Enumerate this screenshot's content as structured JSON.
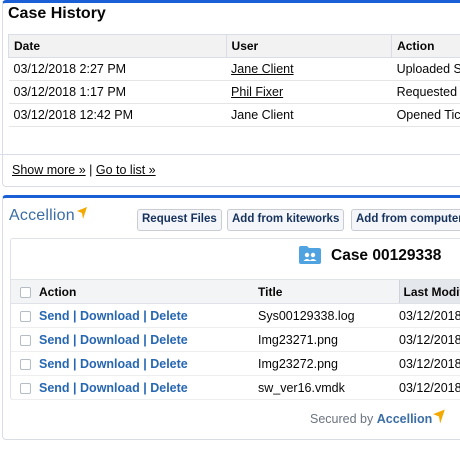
{
  "case_history": {
    "title": "Case History",
    "columns": [
      "Date",
      "User",
      "Action"
    ],
    "rows": [
      {
        "date": "03/12/2018 2:27 PM",
        "user": "Jane Client",
        "user_link": true,
        "action": "Uploaded S"
      },
      {
        "date": "03/12/2018 1:17 PM",
        "user": "Phil Fixer",
        "user_link": true,
        "action": "Requested"
      },
      {
        "date": "03/12/2018 12:42 PM",
        "user": "Jane Client",
        "user_link": false,
        "action": "Opened Tic"
      }
    ],
    "show_more": "Show more »",
    "separator": "|",
    "go_to_list": "Go to list »"
  },
  "accellion": {
    "logo_text": "Accellion",
    "buttons": [
      "Request Files",
      "Add from kiteworks",
      "Add from computer"
    ],
    "case_title": "Case 00129338",
    "columns": [
      "Action",
      "Title",
      "Last Modifi"
    ],
    "row_actions": {
      "send": "Send",
      "sep": "|",
      "download": "Download",
      "delete": "Delete"
    },
    "files": [
      {
        "title": "Sys00129338.log",
        "modified": "03/12/2018"
      },
      {
        "title": "Img23271.png",
        "modified": "03/12/2018"
      },
      {
        "title": "Img23272.png",
        "modified": "03/12/2018"
      },
      {
        "title": "sw_ver16.vmdk",
        "modified": "03/12/2018"
      }
    ],
    "secured_by": "Secured by",
    "secured_brand": "Accellion"
  },
  "colors": {
    "accent": "#1b5fd6",
    "link_blue": "#2767b1",
    "brand_blue": "#3a6ea5",
    "brand_orange": "#f2a900"
  }
}
